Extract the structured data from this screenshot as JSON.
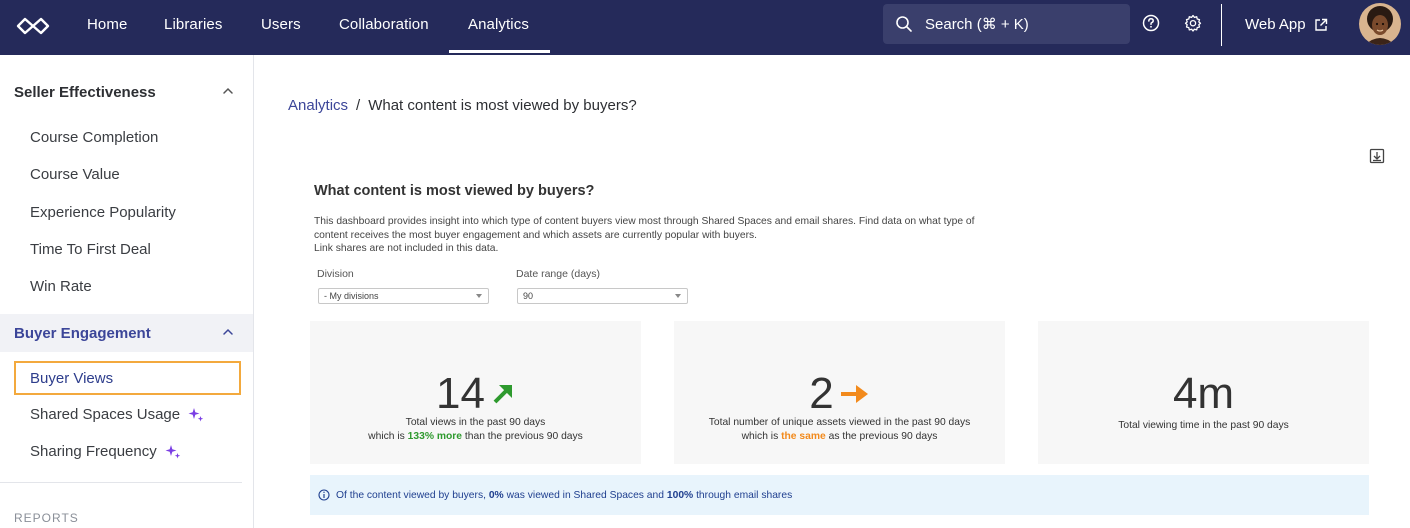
{
  "nav": {
    "items": [
      "Home",
      "Libraries",
      "Users",
      "Collaboration",
      "Analytics"
    ],
    "active": "Analytics",
    "search_placeholder": "Search (⌘ + K)",
    "web_app_label": "Web App"
  },
  "sidebar": {
    "sections": [
      {
        "title": "Seller Effectiveness",
        "items": [
          "Course Completion",
          "Course Value",
          "Experience Popularity",
          "Time To First Deal",
          "Win Rate"
        ]
      },
      {
        "title": "Buyer Engagement",
        "items": [
          "Buyer Views",
          "Shared Spaces Usage",
          "Sharing Frequency"
        ]
      }
    ],
    "selected_item": "Buyer Views",
    "reports_label": "REPORTS"
  },
  "breadcrumb": {
    "parent": "Analytics",
    "separator": "/",
    "current": "What content is most viewed by buyers?"
  },
  "dashboard": {
    "title": "What content is most viewed by buyers?",
    "description_line1": "This dashboard provides insight into which type of content buyers view most through Shared Spaces and email shares. Find data on what type of",
    "description_line2": "content receives the most buyer engagement and which assets are currently popular with buyers.",
    "description_line3": "Link shares are not included in this data.",
    "filters": {
      "division_label": "Division",
      "division_value": "- My divisions",
      "date_range_label": "Date range (days)",
      "date_range_value": "90"
    },
    "cards": [
      {
        "value": "14",
        "line1": "Total views in the past 90 days",
        "line2_prefix": "which is ",
        "line2_highlight": "133% more",
        "line2_suffix": " than the previous 90 days"
      },
      {
        "value": "2",
        "line1": "Total number of unique assets viewed in the past 90 days",
        "line2_prefix": "which is ",
        "line2_highlight": "the same",
        "line2_suffix": " as the previous 90 days"
      },
      {
        "value": "4m",
        "line1": "Total viewing time in the past 90 days"
      }
    ],
    "info": {
      "prefix": "Of the content viewed by buyers, ",
      "shared_pct": "0%",
      "middle": " was viewed in Shared Spaces and ",
      "email_pct": "100%",
      "suffix": " through email shares"
    }
  },
  "colors": {
    "nav_bg": "#252a5a",
    "accent": "#3c4699",
    "selected_border": "#f3a93d",
    "up_green": "#2e9a2e",
    "same_orange": "#f28a1c",
    "sparkle_purple": "#7b3fe4"
  }
}
